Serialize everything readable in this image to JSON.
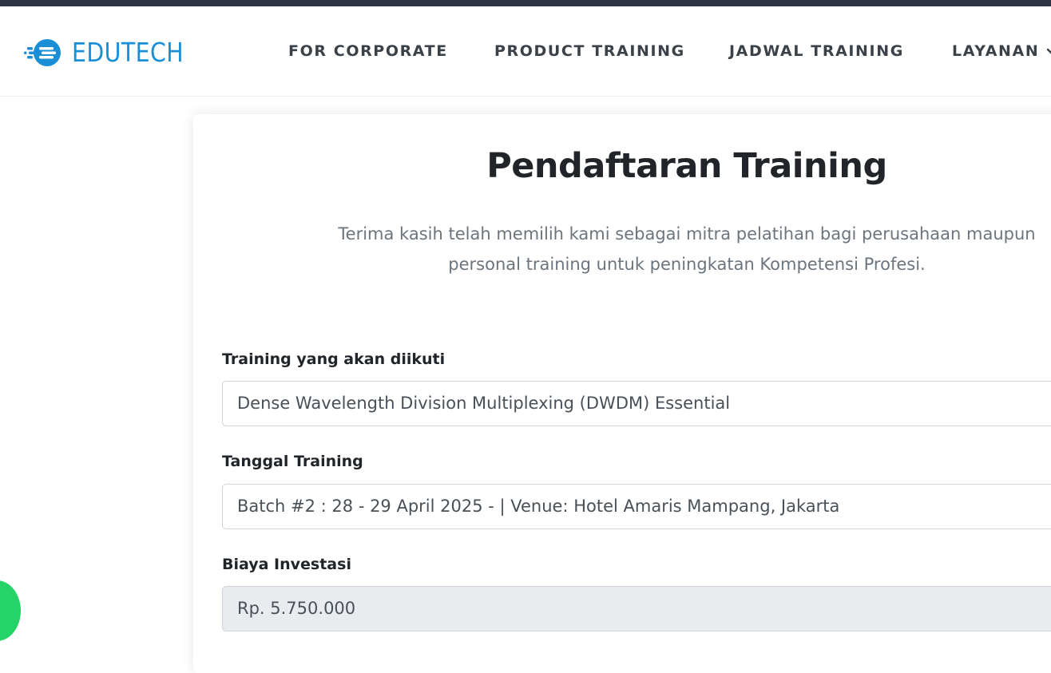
{
  "brand": {
    "name": "EDUTECH",
    "color": "#1b8fd6",
    "icon": "rocket-dots-logo-icon"
  },
  "nav": {
    "items": [
      {
        "label": "FOR CORPORATE"
      },
      {
        "label": "PRODUCT TRAINING"
      },
      {
        "label": "JADWAL TRAINING"
      },
      {
        "label": "LAYANAN",
        "icon": "chevron-down-icon"
      }
    ]
  },
  "form": {
    "title": "Pendaftaran Training",
    "subtitle_line1": "Terima kasih telah memilih kami sebagai mitra pelatihan bagi perusahaan maupun",
    "subtitle_line2": "personal training untuk peningkatan Kompetensi Profesi.",
    "fields": [
      {
        "label": "Training yang akan diikuti",
        "value": "Dense Wavelength Division Multiplexing (DWDM) Essential"
      },
      {
        "label": "Tanggal Training",
        "value": "Batch #2 : 28 - 29 April 2025 - | Venue: Hotel Amaris Mampang, Jakarta"
      },
      {
        "label": "Biaya Investasi",
        "value": "Rp. 5.750.000",
        "readonly": true
      }
    ]
  },
  "widgets": {
    "whatsapp": {
      "icon": "whatsapp-icon",
      "color": "#25d366"
    }
  },
  "colors": {
    "top_strip": "#2b3440",
    "readonly_bg": "#e9ecef",
    "muted_text": "#6c757d"
  }
}
